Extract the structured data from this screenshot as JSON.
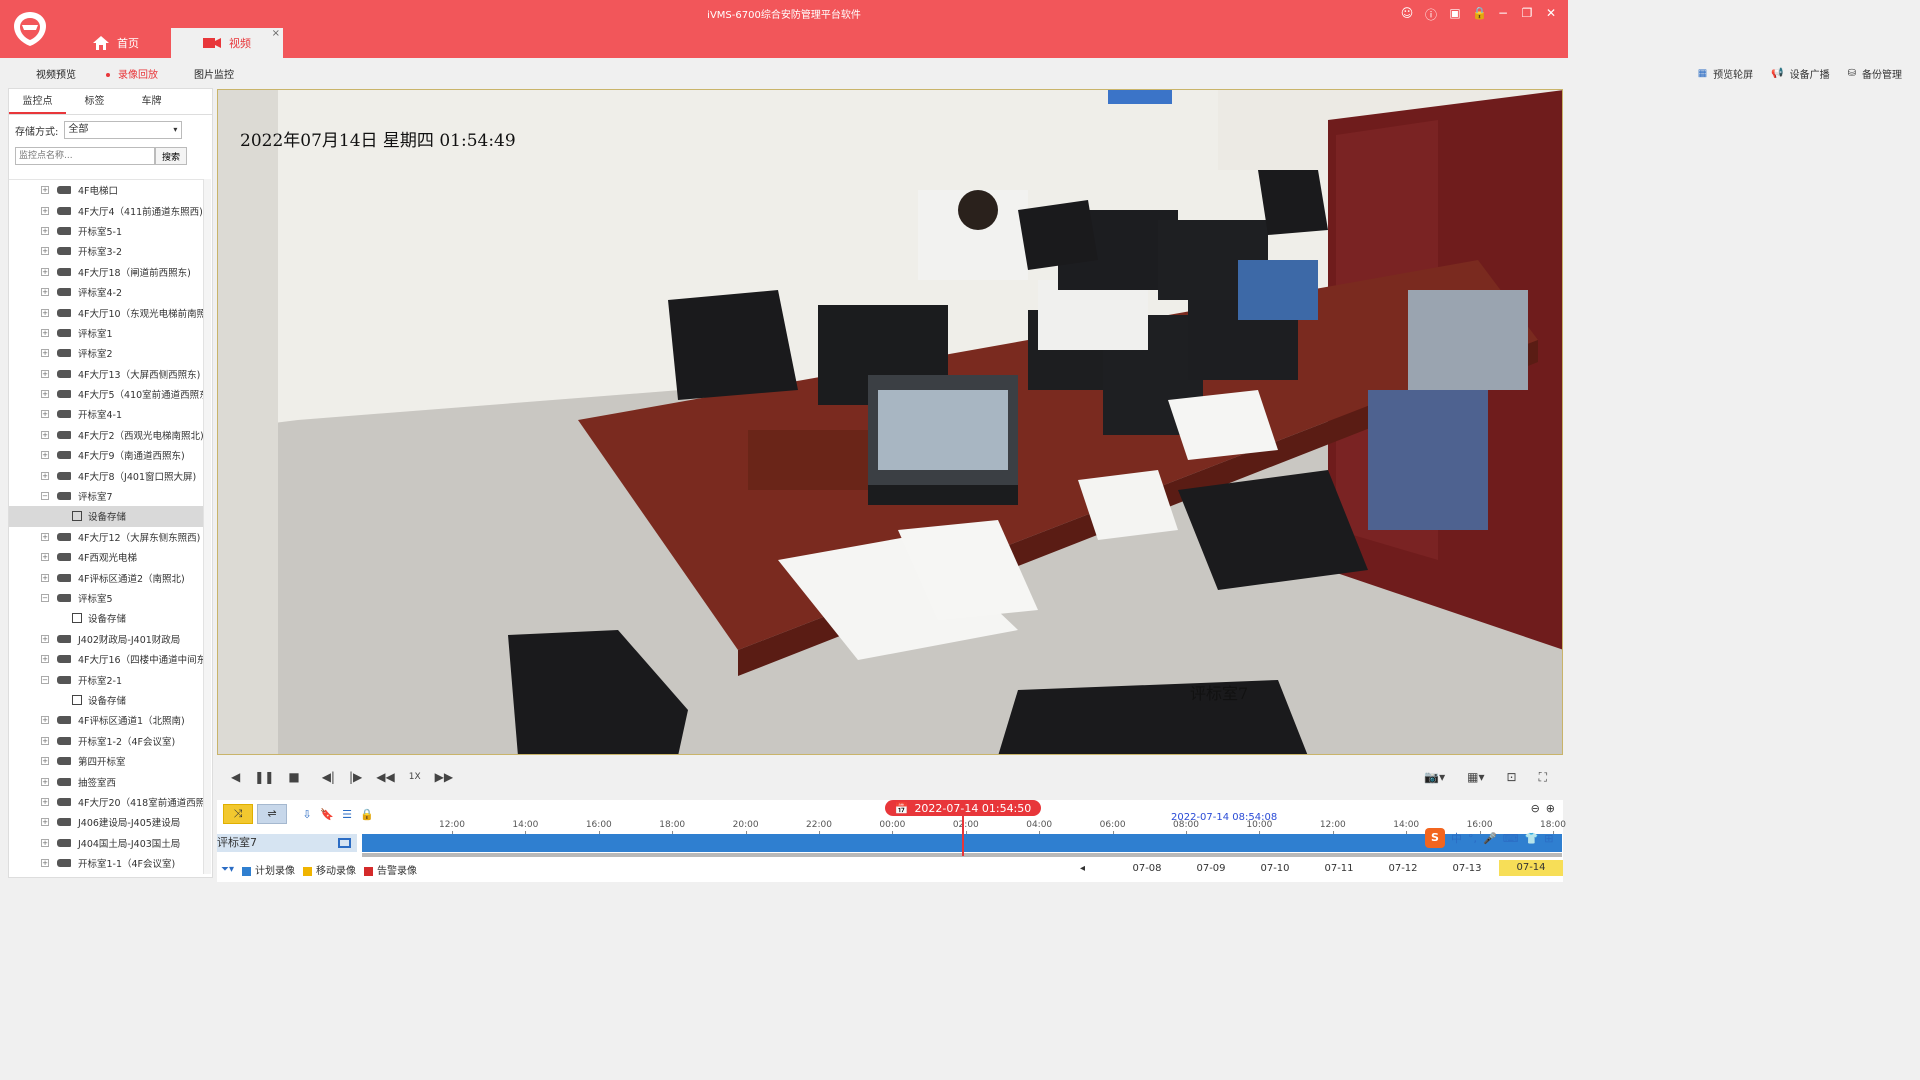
{
  "app": {
    "title": "iVMS-6700综合安防管理平台软件",
    "tabs": [
      {
        "label": "首页",
        "icon": "home-icon"
      },
      {
        "label": "视频",
        "icon": "video-camera-icon",
        "close": "×"
      }
    ],
    "window_icons": [
      "user-icon",
      "info-icon",
      "screenshot-icon",
      "lock-icon",
      "minimize-icon",
      "maximize-icon",
      "close-icon"
    ]
  },
  "subnav": {
    "items": [
      "视频预览",
      "录像回放",
      "图片监控"
    ],
    "right": [
      "预览轮屏",
      "设备广播",
      "备份管理"
    ]
  },
  "sidebar": {
    "tabs": [
      "监控点",
      "标签",
      "车牌"
    ],
    "storage_label": "存储方式:",
    "storage_value": "全部",
    "search_placeholder": "监控点名称...",
    "search_button": "搜索",
    "tree": [
      {
        "label": "4F电梯口",
        "type": "cam",
        "exp": "+"
      },
      {
        "label": "4F大厅4（411前通道东照西)",
        "type": "cam",
        "exp": "+"
      },
      {
        "label": "开标室5-1",
        "type": "cam",
        "exp": "+"
      },
      {
        "label": "开标室3-2",
        "type": "cam",
        "exp": "+"
      },
      {
        "label": "4F大厅18（闸道前西照东)",
        "type": "cam",
        "exp": "+"
      },
      {
        "label": "评标室4-2",
        "type": "cam",
        "exp": "+"
      },
      {
        "label": "4F大厅10（东观光电梯前南照",
        "type": "cam",
        "exp": "+"
      },
      {
        "label": "评标室1",
        "type": "cam",
        "exp": "+"
      },
      {
        "label": "评标室2",
        "type": "cam",
        "exp": "+"
      },
      {
        "label": "4F大厅13（大屏西侧西照东)",
        "type": "cam",
        "exp": "+"
      },
      {
        "label": "4F大厅5（410室前通道西照东",
        "type": "cam",
        "exp": "+"
      },
      {
        "label": "开标室4-1",
        "type": "cam",
        "exp": "+"
      },
      {
        "label": "4F大厅2（西观光电梯南照北)",
        "type": "cam",
        "exp": "+"
      },
      {
        "label": "4F大厅9（南通道西照东)",
        "type": "cam",
        "exp": "+"
      },
      {
        "label": "4F大厅8（J401窗口照大屏)",
        "type": "cam",
        "exp": "+"
      },
      {
        "label": "评标室7",
        "type": "cam",
        "exp": "−"
      },
      {
        "label": "设备存储",
        "type": "child",
        "selected": true
      },
      {
        "label": "4F大厅12（大屏东侧东照西)",
        "type": "cam",
        "exp": "+"
      },
      {
        "label": "4F西观光电梯",
        "type": "cam",
        "exp": "+"
      },
      {
        "label": "4F评标区通道2（南照北)",
        "type": "cam",
        "exp": "+"
      },
      {
        "label": "评标室5",
        "type": "cam",
        "exp": "−"
      },
      {
        "label": "设备存储",
        "type": "child"
      },
      {
        "label": "J402财政局-J401财政局",
        "type": "cam",
        "exp": "+"
      },
      {
        "label": "4F大厅16（四楼中通道中间东",
        "type": "cam",
        "exp": "+"
      },
      {
        "label": "开标室2-1",
        "type": "cam",
        "exp": "−"
      },
      {
        "label": "设备存储",
        "type": "child"
      },
      {
        "label": "4F评标区通道1（北照南)",
        "type": "cam",
        "exp": "+"
      },
      {
        "label": "开标室1-2（4F会议室)",
        "type": "cam",
        "exp": "+"
      },
      {
        "label": "第四开标室",
        "type": "cam",
        "exp": "+"
      },
      {
        "label": "抽签室西",
        "type": "cam",
        "exp": "+"
      },
      {
        "label": "4F大厅20（418室前通道西照",
        "type": "cam",
        "exp": "+"
      },
      {
        "label": "J406建设局-J405建设局",
        "type": "cam",
        "exp": "+"
      },
      {
        "label": "J404国土局-J403国土局",
        "type": "cam",
        "exp": "+"
      },
      {
        "label": "开标室1-1（4F会议室)",
        "type": "cam",
        "exp": "+"
      }
    ]
  },
  "video": {
    "osd_time": "2022年07月14日 星期四 01:54:49",
    "osd_name": "评标室7"
  },
  "controls": {
    "speed": "1X"
  },
  "timeline": {
    "cursor_time": "2022-07-14 01:54:50",
    "hover_time": "2022-07-14 08:54:08",
    "track_name": "评标室7",
    "ticks": [
      "12:00",
      "14:00",
      "16:00",
      "18:00",
      "20:00",
      "22:00",
      "00:00",
      "02:00",
      "04:00",
      "06:00",
      "08:00",
      "10:00",
      "12:00",
      "14:00",
      "16:00",
      "18:00"
    ],
    "legend": [
      {
        "label": "计划录像",
        "color": "#2f7fd0"
      },
      {
        "label": "移动录像",
        "color": "#f0b400"
      },
      {
        "label": "告警录像",
        "color": "#d42a2a"
      }
    ],
    "dates": [
      "07-08",
      "07-09",
      "07-10",
      "07-11",
      "07-12",
      "07-13",
      "07-14"
    ],
    "active_date": "07-14",
    "ime": {
      "logo": "S",
      "lang": "中"
    }
  },
  "colors": {
    "brand": "#f2565a",
    "accent": "#e8363a",
    "track": "#2f7fd0"
  }
}
